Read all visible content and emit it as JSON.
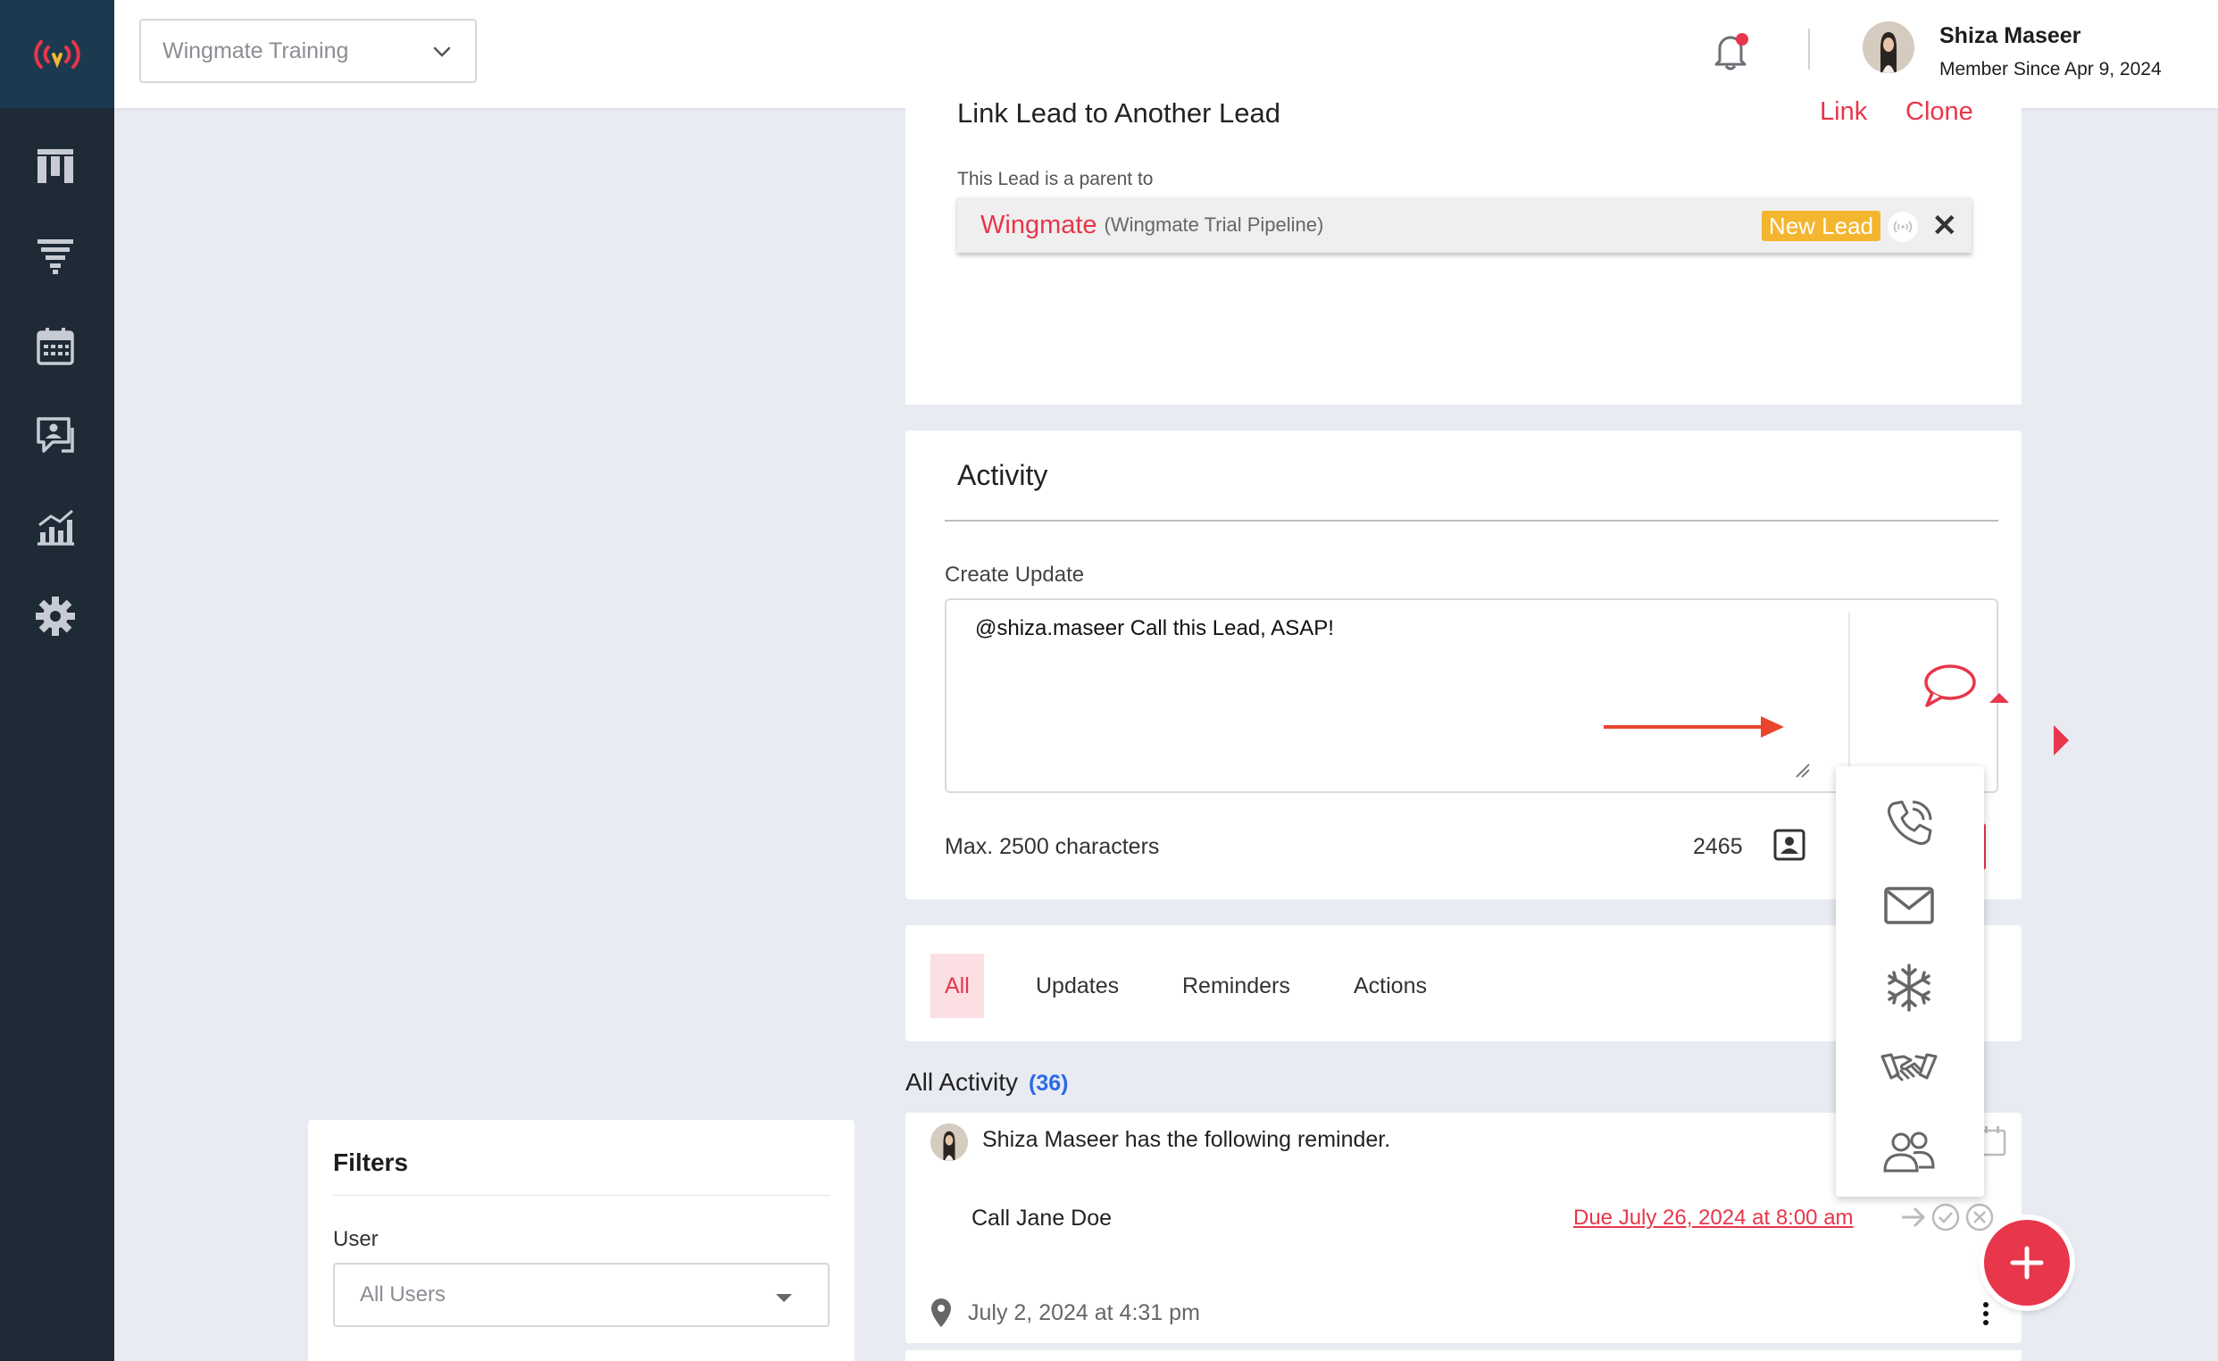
{
  "header": {
    "org_select": "Wingmate Training",
    "user_name": "Shiza Maseer",
    "member_since": "Member Since Apr 9, 2024"
  },
  "sidebar": {
    "items": [
      {
        "icon": "board-icon"
      },
      {
        "icon": "funnel-icon"
      },
      {
        "icon": "calendar-icon"
      },
      {
        "icon": "chat-user-icon"
      },
      {
        "icon": "analytics-icon"
      },
      {
        "icon": "gear-icon"
      }
    ]
  },
  "filters": {
    "title": "Filters",
    "user_label": "User",
    "user_value": "All Users"
  },
  "link_lead": {
    "title": "Link Lead to Another Lead",
    "link_label": "Link",
    "clone_label": "Clone",
    "parent_label": "This Lead is a parent to",
    "lead_name": "Wingmate",
    "lead_pipeline": "(Wingmate Trial Pipeline)",
    "lead_status": "New Lead"
  },
  "activity": {
    "title": "Activity",
    "create_label": "Create Update",
    "textarea_value": "@shiza.maseer Call this Lead, ASAP!",
    "max_chars": "Max. 2500 characters",
    "char_count": "2465"
  },
  "tabs": [
    {
      "label": "All"
    },
    {
      "label": "Updates"
    },
    {
      "label": "Reminders"
    },
    {
      "label": "Actions"
    }
  ],
  "all_activity": {
    "title": "All Activity",
    "count": "(36)"
  },
  "activity_item": {
    "text": "Shiza Maseer has the following  reminder.",
    "task": "Call Jane Doe",
    "due": "Due July 26, 2024 at 8:00 am",
    "date": "July 2, 2024 at 4:31 pm"
  },
  "type_menu": [
    "phone-icon",
    "mail-icon",
    "snowflake-icon",
    "handshake-icon",
    "people-icon"
  ],
  "colors": {
    "accent": "#e8364a",
    "sidebar": "#1e2a36",
    "badge": "#f4b62e",
    "link_blue": "#2a6ae6"
  }
}
